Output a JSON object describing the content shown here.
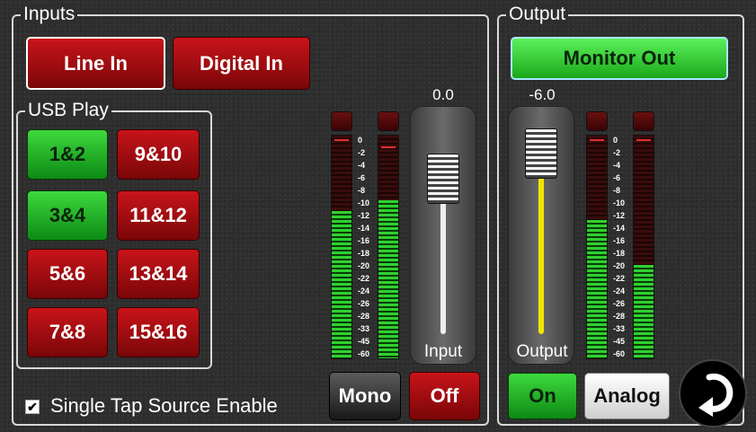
{
  "inputs": {
    "title": "Inputs",
    "line_in": "Line In",
    "digital_in": "Digital In"
  },
  "usb_play": {
    "title": "USB Play",
    "buttons": [
      {
        "label": "1&2",
        "state": "on"
      },
      {
        "label": "9&10",
        "state": "off"
      },
      {
        "label": "3&4",
        "state": "on"
      },
      {
        "label": "11&12",
        "state": "off"
      },
      {
        "label": "5&6",
        "state": "off"
      },
      {
        "label": "13&14",
        "state": "off"
      },
      {
        "label": "7&8",
        "state": "off"
      },
      {
        "label": "15&16",
        "state": "off"
      }
    ]
  },
  "single_tap": {
    "label": "Single Tap Source Enable",
    "checked": true,
    "check_glyph": "✔"
  },
  "input_channel": {
    "value": "0.0",
    "label": "Input",
    "fader_level": 0.78,
    "meter_left_level": 0.66,
    "meter_right_level": 0.71,
    "mono": "Mono",
    "off": "Off"
  },
  "scale_ticks": [
    "0",
    "-2",
    "-4",
    "-6",
    "-8",
    "-10",
    "-12",
    "-14",
    "-16",
    "-18",
    "-20",
    "-22",
    "-24",
    "-26",
    "-28",
    "-33",
    "-45",
    "-60"
  ],
  "output": {
    "title": "Output",
    "monitor_out": "Monitor Out",
    "value": "-6.0",
    "label": "Output",
    "fader_level": 0.93,
    "meter_left_level": 0.62,
    "meter_right_level": 0.42,
    "on": "On",
    "analog": "Analog"
  },
  "icons": {
    "back": "return-arrow-icon"
  },
  "colors": {
    "red": "#b01015",
    "green": "#22c022",
    "yellow": "#f2e600"
  }
}
